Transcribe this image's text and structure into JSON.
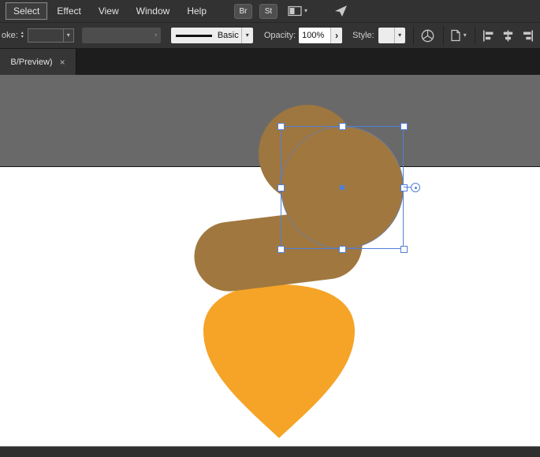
{
  "menubar": {
    "items": [
      {
        "label": "Select"
      },
      {
        "label": "Effect"
      },
      {
        "label": "View"
      },
      {
        "label": "Window"
      },
      {
        "label": "Help"
      }
    ],
    "bridge_badge": "Br",
    "stock_badge": "St"
  },
  "controlbar": {
    "stroke_label": "oke:",
    "brush_name": "Basic",
    "opacity_label": "Opacity:",
    "opacity_value": "100%",
    "style_label": "Style:"
  },
  "tabbar": {
    "title": "B/Preview)"
  },
  "glyphs": {
    "chevron": "▾",
    "step_up": "▴",
    "step_down": "▾",
    "panel_arrow": "›",
    "close": "×"
  },
  "colors": {
    "selection_blue": "#4F7FD9",
    "acorn_brown": "#A0783F",
    "acorn_orange": "#F5A427",
    "pasteboard_gray": "#696969",
    "ui_dark": "#323232"
  }
}
